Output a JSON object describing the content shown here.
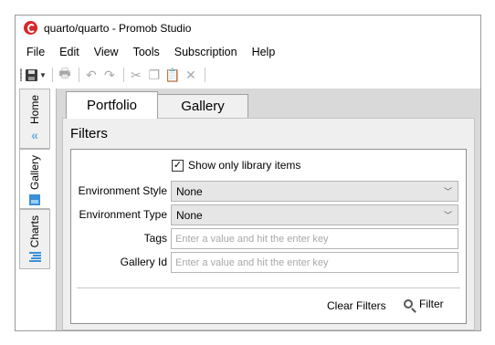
{
  "window": {
    "title": "quarto/quarto - Promob Studio",
    "accent_color": "#d8262a"
  },
  "menu": [
    "File",
    "Edit",
    "View",
    "Tools",
    "Subscription",
    "Help"
  ],
  "toolbar": {
    "icons": [
      "save-icon",
      "print-icon",
      "undo-icon",
      "redo-icon",
      "cut-icon",
      "copy-icon",
      "paste-icon",
      "delete-icon"
    ]
  },
  "sidebar": {
    "tabs": [
      {
        "label": "Home",
        "icon": "home-icon"
      },
      {
        "label": "Gallery",
        "icon": "gallery-icon"
      },
      {
        "label": "Charts",
        "icon": "charts-icon"
      }
    ]
  },
  "main": {
    "tabs": [
      {
        "label": "Portfolio"
      },
      {
        "label": "Gallery"
      }
    ],
    "filters": {
      "title": "Filters",
      "show_library_label": "Show only library items",
      "show_library_checked": true,
      "environment_style": {
        "label": "Environment Style",
        "value": "None"
      },
      "environment_type": {
        "label": "Environment Type",
        "value": "None"
      },
      "tags": {
        "label": "Tags",
        "placeholder": "Enter a value and hit the enter key"
      },
      "gallery_id": {
        "label": "Gallery Id",
        "placeholder": "Enter a value and hit the enter key"
      },
      "clear_label": "Clear Filters",
      "filter_label": "Filter"
    }
  }
}
